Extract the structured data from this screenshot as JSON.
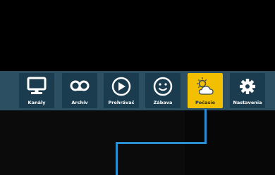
{
  "menu": {
    "items": [
      {
        "label": "Kanály",
        "icon": "tv-icon"
      },
      {
        "label": "Archív",
        "icon": "archive-tape-icon"
      },
      {
        "label": "Prehrávač",
        "icon": "play-icon"
      },
      {
        "label": "Zábava",
        "icon": "smiley-icon"
      },
      {
        "label": "Počasie",
        "icon": "weather-icon"
      },
      {
        "label": "Nastavenia",
        "icon": "gear-icon"
      }
    ],
    "selected": "Počasie"
  },
  "colors": {
    "bar": "#2c4f61",
    "tile": "#1b3c4f",
    "active_tile": "#f2c000",
    "connector": "#2a8fd0"
  }
}
